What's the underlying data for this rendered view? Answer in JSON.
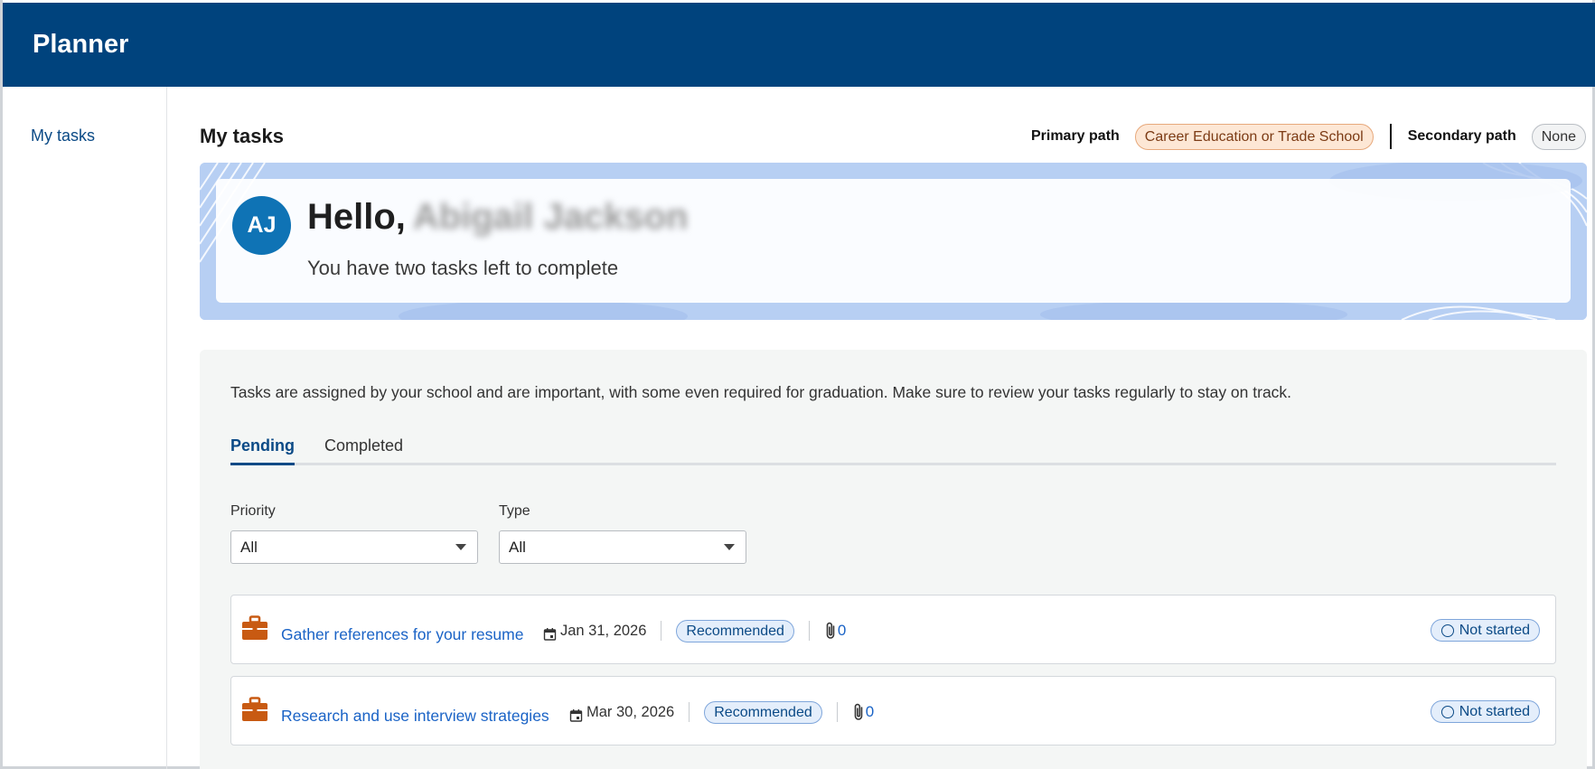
{
  "app": {
    "title": "Planner"
  },
  "sidebar": {
    "items": [
      {
        "label": "My tasks"
      }
    ]
  },
  "page": {
    "title": "My tasks"
  },
  "paths": {
    "primary_label": "Primary path",
    "primary_value": "Career Education or Trade School",
    "secondary_label": "Secondary path",
    "secondary_value": "None"
  },
  "hero": {
    "avatar_initials": "AJ",
    "greeting": "Hello,",
    "name": "Abigail Jackson",
    "subtitle": "You have two tasks left to complete"
  },
  "panel": {
    "intro": "Tasks are assigned by your school and are important, with some even required for graduation. Make sure to review your tasks regularly to stay on track.",
    "tabs": [
      {
        "label": "Pending",
        "active": true
      },
      {
        "label": "Completed",
        "active": false
      }
    ],
    "filters": {
      "priority": {
        "label": "Priority",
        "value": "All"
      },
      "type": {
        "label": "Type",
        "value": "All"
      }
    }
  },
  "tasks": [
    {
      "title": "Gather references for your resume",
      "due": "Jan 31, 2026",
      "priority": "Recommended",
      "attachments": "0",
      "status": "Not started",
      "icon": "briefcase-icon"
    },
    {
      "title": "Research and use interview strategies",
      "due": "Mar 30, 2026",
      "priority": "Recommended",
      "attachments": "0",
      "status": "Not started",
      "icon": "briefcase-icon"
    }
  ],
  "colors": {
    "header": "#00437d",
    "accent": "#0b4a86",
    "link": "#1a63c6",
    "briefcase": "#c85a12"
  }
}
